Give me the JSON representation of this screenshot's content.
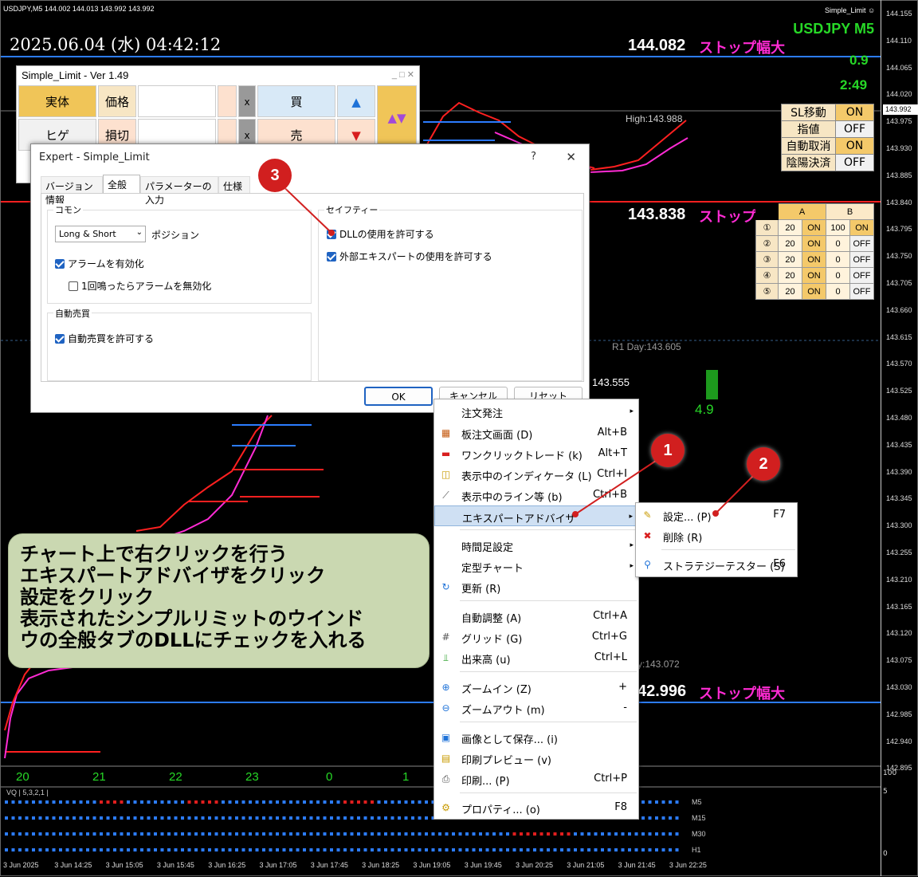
{
  "window": {
    "title_bar": "USDJPY,M5  144.002 144.013 143.992 143.992",
    "ea_name_top": "Simple_Limit",
    "smile_icon": "smile-icon"
  },
  "clock": "2025.06.04 (水) 04:42:12",
  "symbol": "USDJPY  M5",
  "top_right_values": {
    "spread": "0.9",
    "timer": "2:49"
  },
  "lines": {
    "upper_price": "144.082",
    "upper_label": "ストップ幅大",
    "lower_price": "143.838",
    "lower_label": "ストップ幅大",
    "bottom_price": "42.996",
    "bottom_label": "ストップ幅大"
  },
  "labels": {
    "high": "High:143.988",
    "r1day": "R1 Day:143.605",
    "price_mid": "143.555",
    "green_value": "4.9",
    "day_price": "y:143.072"
  },
  "status_panel": [
    {
      "key": "SL移動",
      "value": "ON"
    },
    {
      "key": "指値",
      "value": "OFF"
    },
    {
      "key": "自動取消",
      "value": "ON"
    },
    {
      "key": "陰陽決済",
      "value": "OFF"
    }
  ],
  "ab_table": {
    "header_a": "A",
    "header_b": "B",
    "rows": [
      {
        "n": "①",
        "a1": "20",
        "a2": "ON",
        "b1": "100",
        "b2": "ON"
      },
      {
        "n": "②",
        "a1": "20",
        "a2": "ON",
        "b1": "0",
        "b2": "OFF"
      },
      {
        "n": "③",
        "a1": "20",
        "a2": "ON",
        "b1": "0",
        "b2": "OFF"
      },
      {
        "n": "④",
        "a1": "20",
        "a2": "ON",
        "b1": "0",
        "b2": "OFF"
      },
      {
        "n": "⑤",
        "a1": "20",
        "a2": "ON",
        "b1": "0",
        "b2": "OFF"
      }
    ]
  },
  "price_axis": [
    "144.155",
    "144.110",
    "144.065",
    "144.020",
    "143.975",
    "143.930",
    "143.885",
    "143.840",
    "143.795",
    "143.750",
    "143.705",
    "143.660",
    "143.615",
    "143.570",
    "143.525",
    "143.480",
    "143.435",
    "143.390",
    "143.345",
    "143.300",
    "143.255",
    "143.210",
    "143.165",
    "143.120",
    "143.075",
    "143.030",
    "142.985",
    "142.940",
    "142.895"
  ],
  "price_tags": {
    "current": "143.992"
  },
  "sub_axis": {
    "top": "5",
    "mid": "100",
    "bottom": "0"
  },
  "simple_limit_panel": {
    "title": "Simple_Limit - Ver 1.49",
    "row1": {
      "label": "実体",
      "field": "価格",
      "x": "x",
      "action": "買",
      "arrow": "▲"
    },
    "row2": {
      "label": "ヒゲ",
      "field": "損切",
      "x": "x",
      "action": "売",
      "arrow": "▼"
    },
    "updown": "▲▼",
    "win_controls": "_ □ ✕"
  },
  "dialog": {
    "title": "Expert - Simple_Limit",
    "help": "?",
    "close": "✕",
    "tabs": [
      "バージョン情報",
      "全般",
      "パラメーターの入力",
      "仕様"
    ],
    "group_common": "コモン",
    "position_select": "Long & Short",
    "position_label": "ポジション",
    "alarm_enable": "アラームを有効化",
    "alarm_once": "1回鳴ったらアラームを無効化",
    "group_auto": "自動売買",
    "auto_allow": "自動売買を許可する",
    "group_safety": "セイフティー",
    "dll_allow": "DLLの使用を許可する",
    "external_ea": "外部エキスパートの使用を許可する",
    "ok": "OK",
    "cancel": "キャンセル",
    "reset": "リセット"
  },
  "context_menu": {
    "top_partial": "注文発注",
    "items": [
      {
        "label": "板注文画面 (D)",
        "shortcut": "Alt+B",
        "icon": "grid-icon"
      },
      {
        "label": "ワンクリックトレード (k)",
        "shortcut": "Alt+T",
        "icon": "one-click-icon"
      },
      {
        "label": "表示中のインディケータ (L)",
        "shortcut": "Ctrl+I",
        "icon": "indicator-icon"
      },
      {
        "label": "表示中のライン等 (b)",
        "shortcut": "Ctrl+B",
        "icon": "lines-icon"
      },
      {
        "label": "エキスパートアドバイザ",
        "shortcut": "",
        "icon": ""
      },
      {
        "label": "時間足設定",
        "shortcut": "",
        "icon": ""
      },
      {
        "label": "定型チャート",
        "shortcut": "",
        "icon": ""
      },
      {
        "label": "更新 (R)",
        "shortcut": "",
        "icon": "refresh-icon"
      },
      {
        "label": "自動調整 (A)",
        "shortcut": "Ctrl+A",
        "icon": ""
      },
      {
        "label": "グリッド (G)",
        "shortcut": "Ctrl+G",
        "icon": "grid-lines-icon"
      },
      {
        "label": "出来高 (u)",
        "shortcut": "Ctrl+L",
        "icon": "volume-icon"
      },
      {
        "label": "ズームイン (Z)",
        "shortcut": "+",
        "icon": "zoom-in-icon"
      },
      {
        "label": "ズームアウト (m)",
        "shortcut": "-",
        "icon": "zoom-out-icon"
      },
      {
        "label": "画像として保存... (i)",
        "shortcut": "",
        "icon": "save-image-icon"
      },
      {
        "label": "印刷プレビュー (v)",
        "shortcut": "",
        "icon": "print-preview-icon"
      },
      {
        "label": "印刷... (P)",
        "shortcut": "Ctrl+P",
        "icon": "print-icon"
      },
      {
        "label": "プロパティ... (o)",
        "shortcut": "F8",
        "icon": "properties-icon"
      }
    ]
  },
  "sub_menu": [
    {
      "label": "設定... (P)",
      "shortcut": "F7"
    },
    {
      "label": "削除 (R)",
      "shortcut": ""
    },
    {
      "label": "ストラテジーテスター (S)",
      "shortcut": "F6"
    }
  ],
  "instructions": [
    "チャート上で右クリックを行う",
    "エキスパートアドバイザをクリック",
    "設定をクリック",
    "表示されたシンプルリミットのウインド",
    "ウの全般タブのDLLにチェックを入れる"
  ],
  "badges": [
    "1",
    "2",
    "3"
  ],
  "day_numbers": [
    "20",
    "21",
    "22",
    "23",
    "0",
    "1"
  ],
  "vq_label": "VQ | 5,3,2,1 |",
  "vq_rows": [
    "M5",
    "M15",
    "M30",
    "H1"
  ],
  "date_axis": [
    "3 Jun 2025",
    "3 Jun 14:25",
    "3 Jun 15:05",
    "3 Jun 15:45",
    "3 Jun 16:25",
    "3 Jun 17:05",
    "3 Jun 17:45",
    "3 Jun 18:25",
    "3 Jun 19:05",
    "3 Jun 19:45",
    "3 Jun 20:25",
    "3 Jun 21:05",
    "3 Jun 21:45",
    "3 Jun 22:25"
  ],
  "colors": {
    "stop_label": "#ff2bd4",
    "accent_green": "#27d827",
    "line_blue": "#2c7cff",
    "line_red": "#ff2020",
    "badge": "#d11f1f"
  }
}
